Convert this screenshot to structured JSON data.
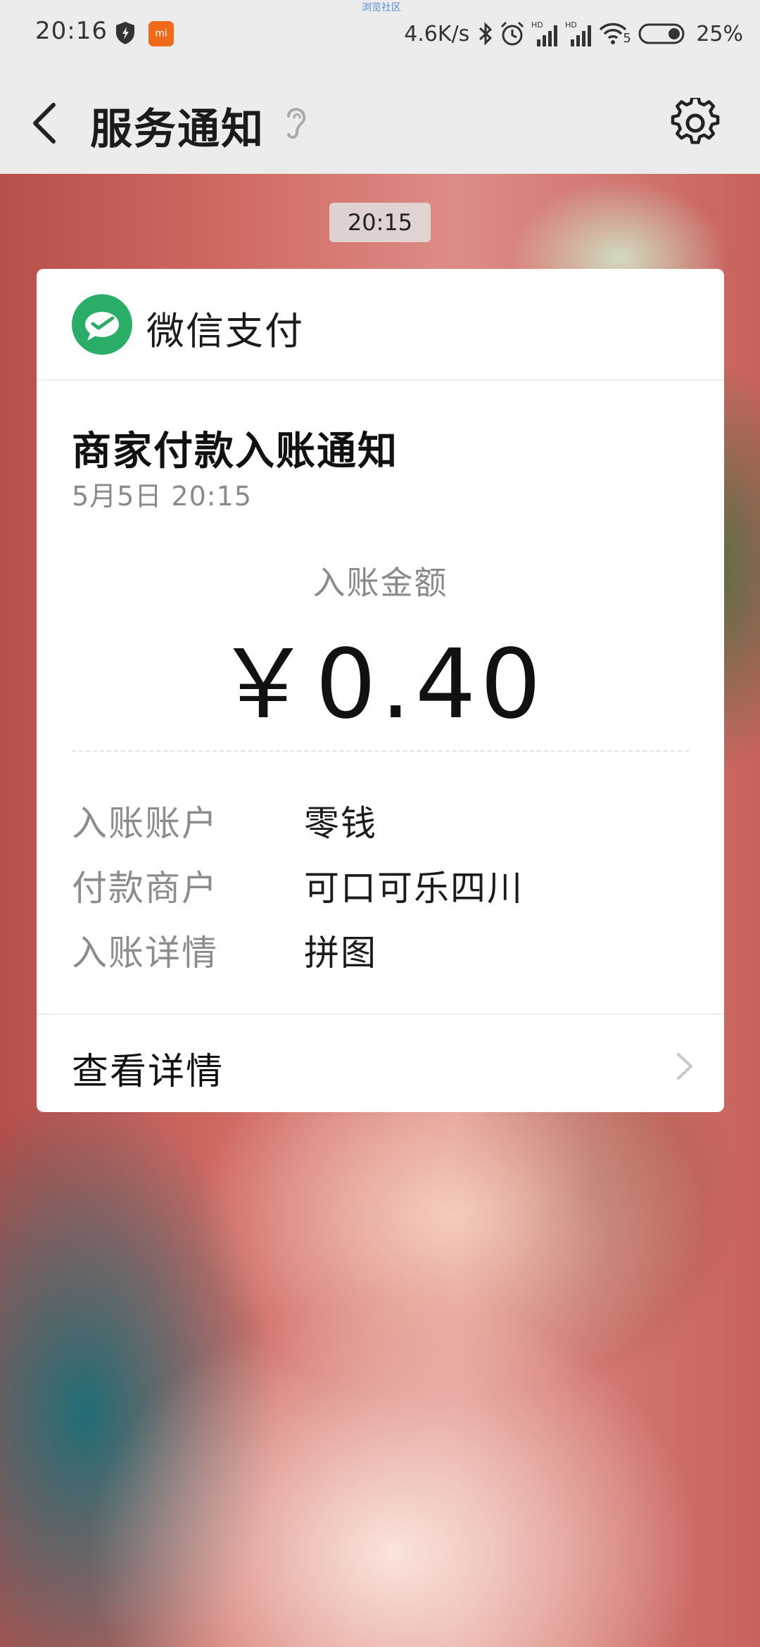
{
  "status_bar": {
    "time": "20:16",
    "watermark": "浏览社区",
    "speed": "4.6K/s",
    "wifi_label": "5",
    "battery_pct": "25%",
    "app_badge": "mi"
  },
  "header": {
    "title": "服务通知"
  },
  "chat": {
    "time_chip": "20:15"
  },
  "card": {
    "brand_name": "微信支付",
    "brand_color": "#2aae67",
    "title": "商家付款入账通知",
    "datetime": "5月5日  20:15",
    "amount_label": "入账金额",
    "amount": "￥0.40",
    "rows": [
      {
        "label": "入账账户",
        "value": "零钱"
      },
      {
        "label": "付款商户",
        "value": "可口可乐四川"
      },
      {
        "label": "入账详情",
        "value": "拼图"
      }
    ],
    "footer_label": "查看详情"
  }
}
